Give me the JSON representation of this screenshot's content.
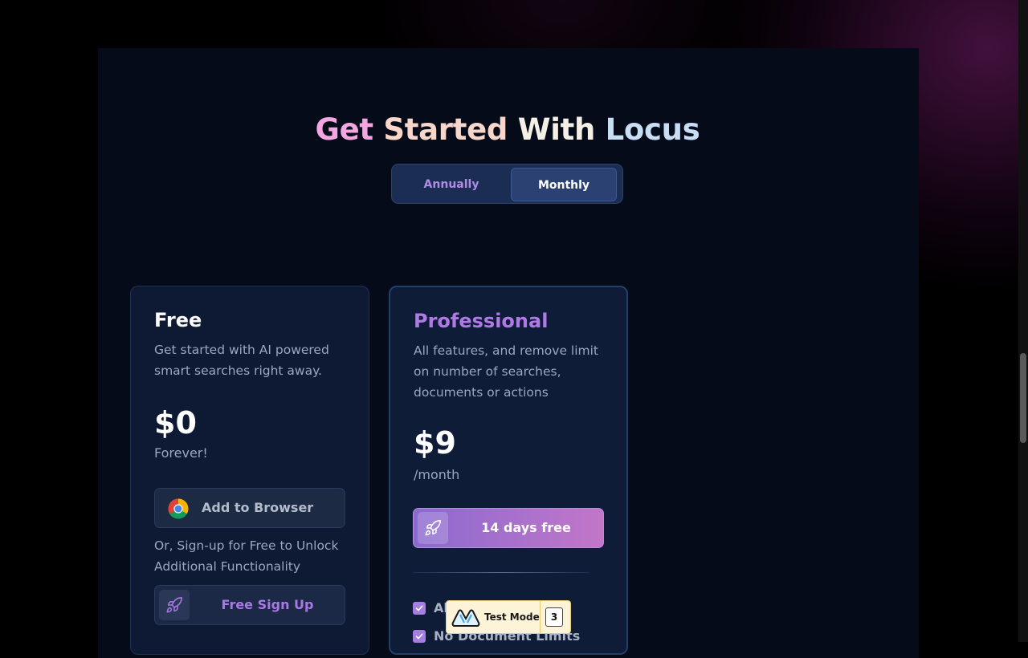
{
  "header": {
    "title_words": [
      "Get",
      "Started",
      "With",
      "Locus"
    ],
    "title_colors": [
      "#f3a6e0",
      "#f8d6c9",
      "#f4f0e6",
      "#c7def5"
    ]
  },
  "billing_toggle": {
    "annually_label": "Annually",
    "monthly_label": "Monthly",
    "selected": "Monthly"
  },
  "plans": {
    "free": {
      "title": "Free",
      "description": "Get started with AI powered smart searches right away.",
      "price": "$0",
      "period": "Forever!",
      "browser_button_label": "Add to Browser",
      "browser_button_icon": "chrome-icon",
      "alt_text": "Or, Sign-up for Free to Unlock Additional Functionality",
      "signup_button_label": "Free Sign Up",
      "signup_button_icon": "rocket-icon"
    },
    "professional": {
      "title": "Professional",
      "description": "All features, and remove limit on number of searches, documents or actions",
      "price": "$9",
      "period": "/month",
      "trial_button_label": "14 days free",
      "trial_button_icon": "rocket-icon",
      "features": [
        {
          "label": "Al",
          "checked": true
        },
        {
          "label": "No Document Limits",
          "checked": true
        }
      ]
    }
  },
  "test_mode_badge": {
    "label": "Test Mode",
    "count": "3"
  },
  "colors": {
    "accent_purple": "#a878e6",
    "background": "#060b1a",
    "card": "#0e1a33"
  }
}
